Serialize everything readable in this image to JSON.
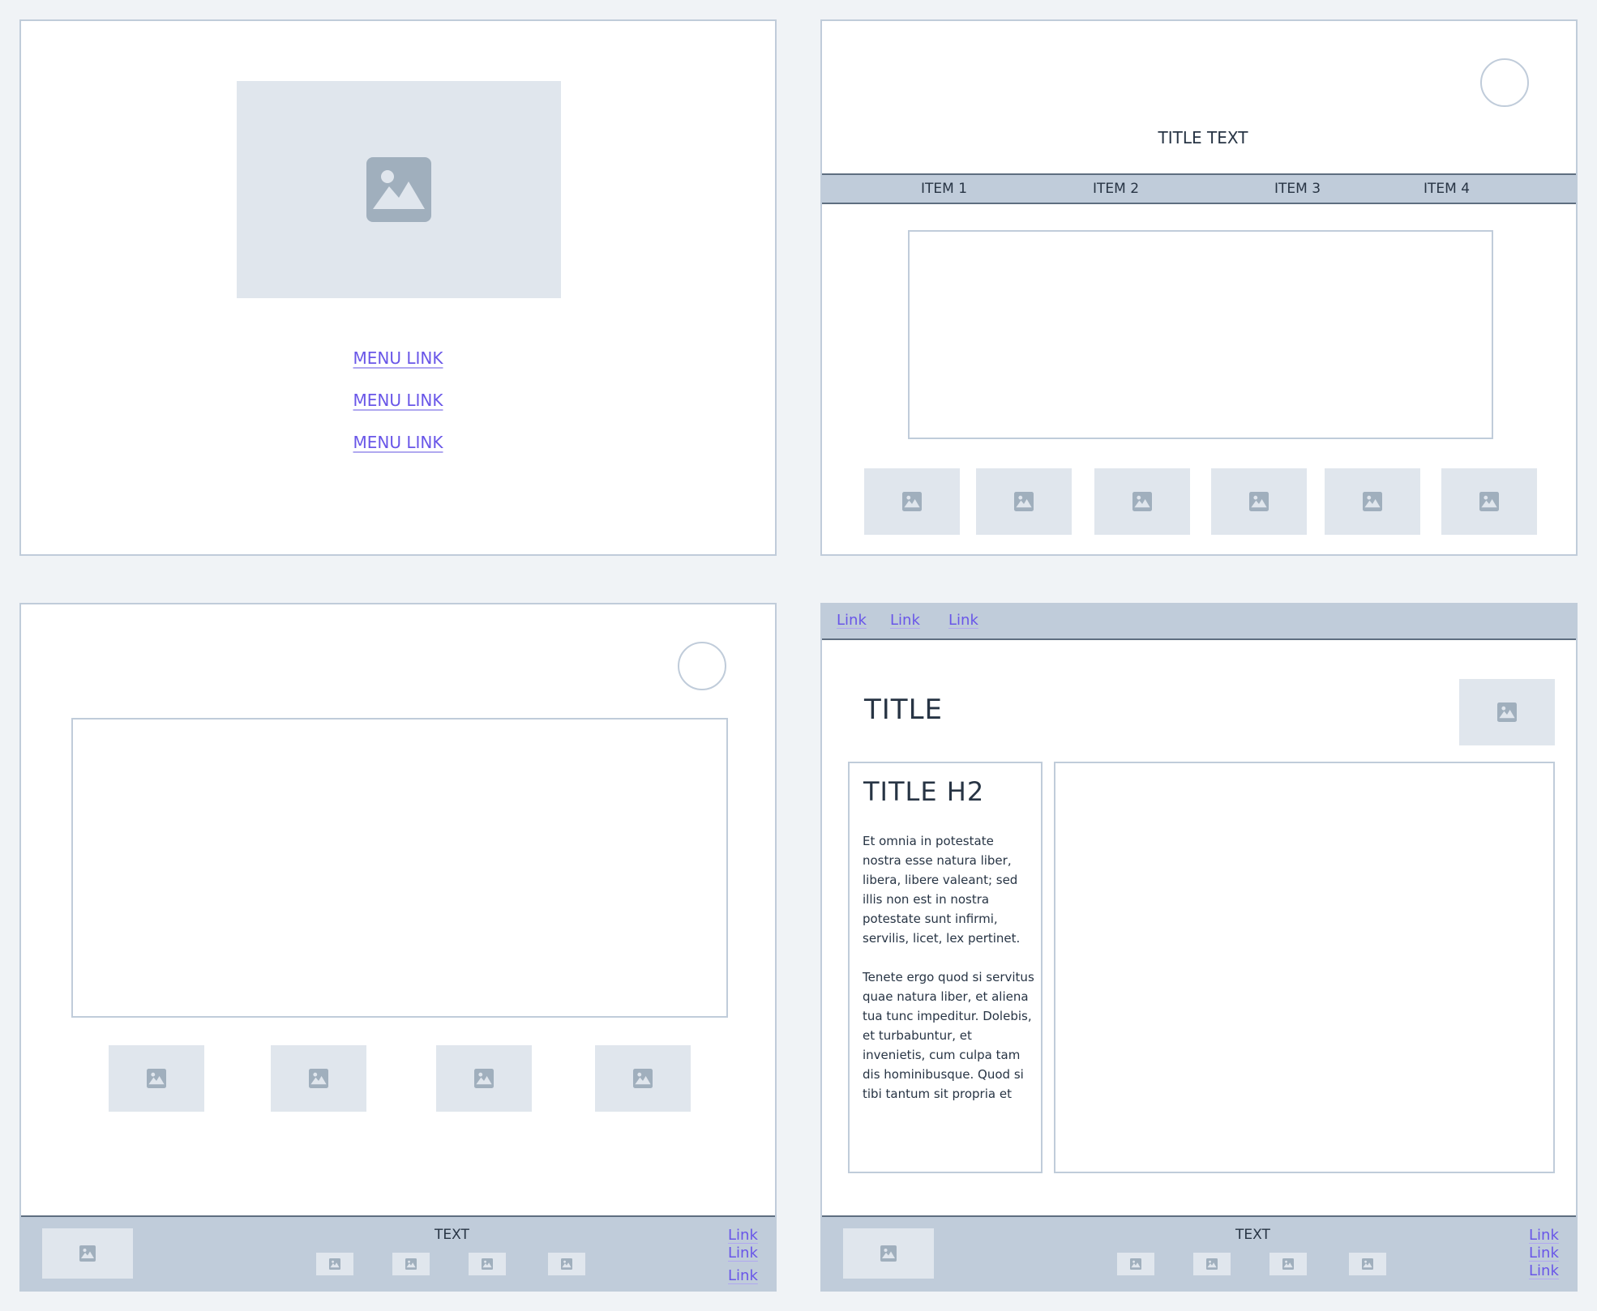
{
  "frame1": {
    "menu_links": [
      "MENU LINK",
      "MENU LINK",
      "MENU LINK"
    ]
  },
  "frame2": {
    "title": "TITLE TEXT",
    "nav_items": [
      "ITEM 1",
      "ITEM 2",
      "ITEM 3",
      "ITEM 4"
    ]
  },
  "frame3": {
    "footer": {
      "text": "TEXT",
      "links": [
        "Link",
        "Link",
        "Link"
      ]
    }
  },
  "frame4": {
    "top_links": [
      "Link",
      "Link",
      "Link"
    ],
    "title": "TITLE",
    "h2": "TITLE H2",
    "paragraph1": "Et omnia in potestate nostra esse natura liber, libera, libere valeant; sed illis non est in nostra potestate sunt infirmi, servilis, licet, lex pertinet.",
    "paragraph2": "Tenete ergo quod si servitus quae natura liber, et aliena tua tunc impeditur. Dolebis, et turbabuntur, et invenietis, cum culpa tam dis hominibusque. Quod si tibi tantum sit propria et",
    "footer": {
      "text": "TEXT",
      "links": [
        "Link",
        "Link",
        "Link"
      ]
    }
  },
  "icons": {
    "placeholder": "image-icon"
  },
  "colors": {
    "link": "#6956e8",
    "placeholder": "#e0e6ed",
    "icon": "#a0afbd",
    "border": "#c0ccda"
  }
}
